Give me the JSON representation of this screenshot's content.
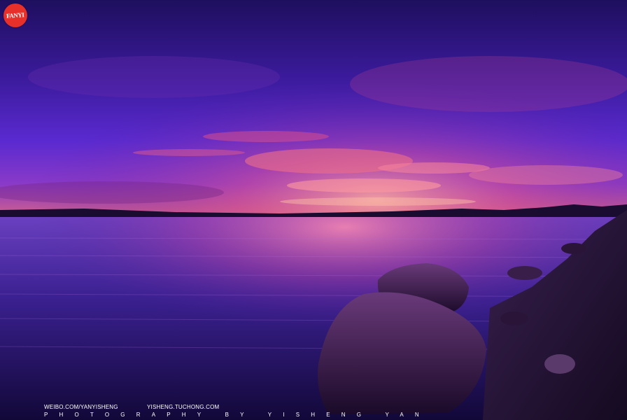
{
  "logo": {
    "text": "FANYI"
  },
  "footer": {
    "weibo_url": "WEIBO.COM/YANYISHENG",
    "tuchong_url": "YISHENG.TUCHONG.COM",
    "credit": "PHOTOGRAPHY BY YISHENG YAN"
  }
}
